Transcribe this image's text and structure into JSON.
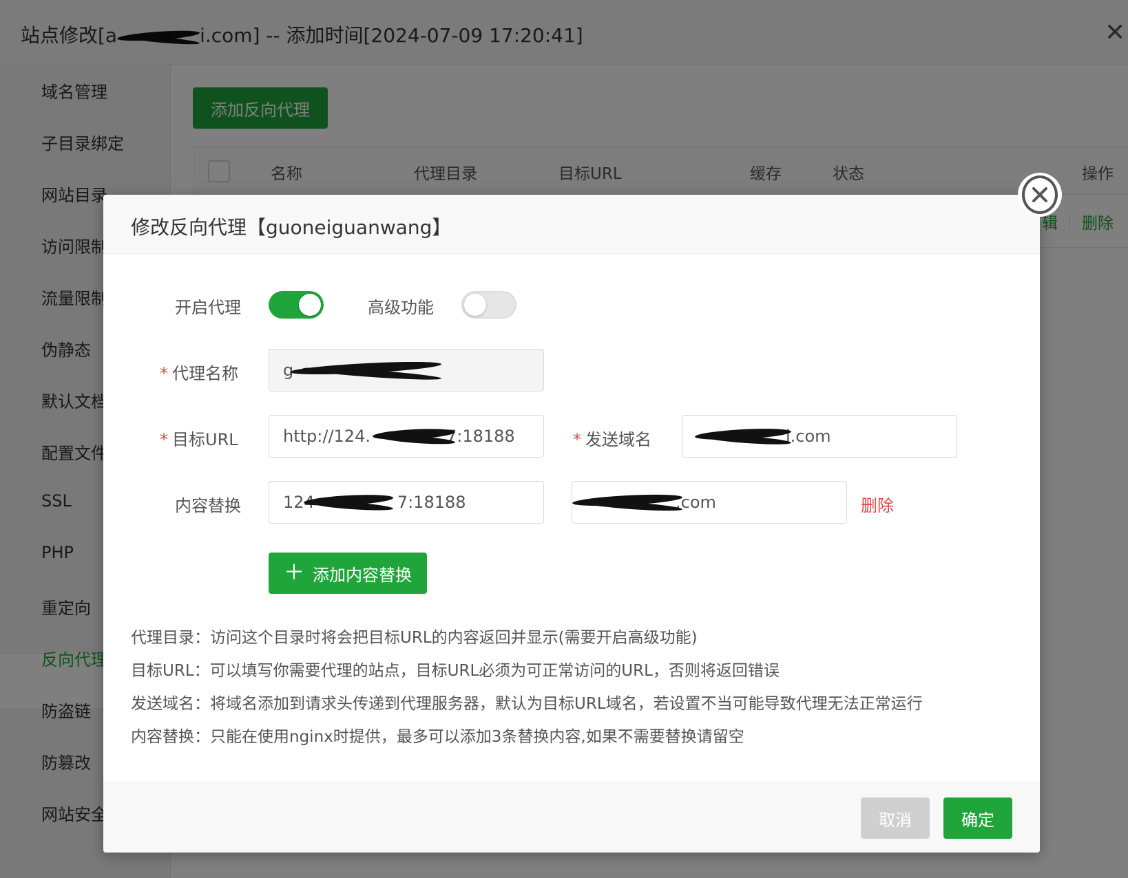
{
  "window": {
    "title_prefix": "站点修改[a",
    "title_suffix": "i.com] -- 添加时间[2024-07-09 17:20:41]"
  },
  "sidebar": {
    "items": [
      {
        "label": "域名管理"
      },
      {
        "label": "子目录绑定"
      },
      {
        "label": "网站目录"
      },
      {
        "label": "访问限制"
      },
      {
        "label": "流量限制"
      },
      {
        "label": "伪静态"
      },
      {
        "label": "默认文档"
      },
      {
        "label": "配置文件"
      },
      {
        "label": "SSL"
      },
      {
        "label": "PHP"
      },
      {
        "label": "重定向"
      },
      {
        "label": "反向代理"
      },
      {
        "label": "防盗链"
      },
      {
        "label": "防篡改"
      },
      {
        "label": "网站安全"
      }
    ],
    "active_index": 11
  },
  "main": {
    "add_proxy_label": "添加反向代理",
    "table": {
      "headers": [
        "名称",
        "代理目录",
        "目标URL",
        "缓存",
        "状态",
        "操作"
      ],
      "row_actions": [
        "辑",
        "删除"
      ]
    }
  },
  "modal": {
    "title": "修改反向代理【guoneiguanwang】",
    "enable_proxy_label": "开启代理",
    "enable_proxy_on": true,
    "advanced_label": "高级功能",
    "advanced_on": false,
    "proxy_name_label": "代理名称",
    "proxy_name_value": "g",
    "target_url_label": "目标URL",
    "target_url_prefix": "http://124.",
    "target_url_suffix": "7:18188",
    "send_domain_label": "发送域名",
    "send_domain_suffix": "i.com",
    "replace_label": "内容替换",
    "replace_from_prefix": "124",
    "replace_from_suffix": "7:18188",
    "replace_to_suffix": ".com",
    "replace_delete_label": "删除",
    "add_replace_label": "添加内容替换",
    "tips": [
      "代理目录：访问这个目录时将会把目标URL的内容返回并显示(需要开启高级功能)",
      "目标URL：可以填写你需要代理的站点，目标URL必须为可正常访问的URL，否则将返回错误",
      "发送域名：将域名添加到请求头传递到代理服务器，默认为目标URL域名，若设置不当可能导致代理无法正常运行",
      "内容替换：只能在使用nginx时提供，最多可以添加3条替换内容,如果不需要替换请留空"
    ],
    "cancel_label": "取消",
    "ok_label": "确定"
  },
  "colors": {
    "accent": "#20a53a",
    "danger": "#e04545"
  }
}
